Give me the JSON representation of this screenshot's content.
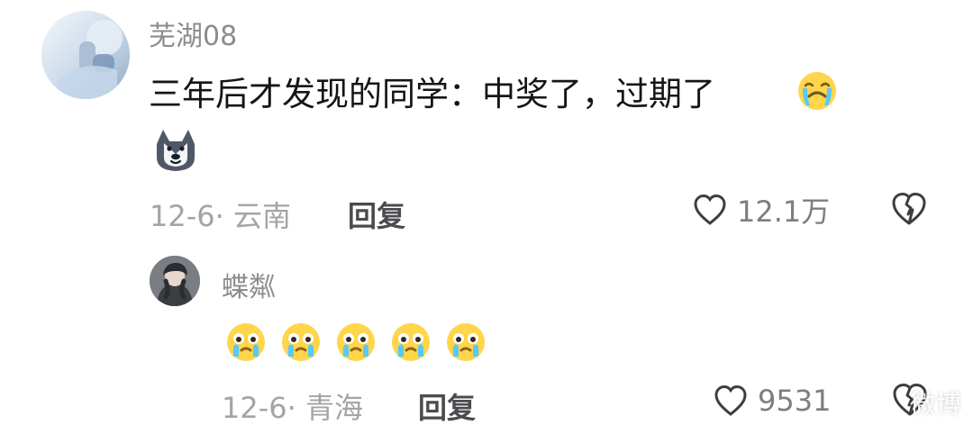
{
  "comments": [
    {
      "username": "芜湖08",
      "text": "三年后才发现的同学：中奖了，过期了",
      "time_location": "12-6· 云南",
      "reply_label": "回复",
      "likes": "12.1万",
      "icons": {
        "crying_emoji": "crying-emoji-icon",
        "dog_sticker": "husky-sticker-icon",
        "heart": "heart-outline-icon",
        "dislike": "broken-heart-icon"
      }
    },
    {
      "username": "蝶粼",
      "time_location": "12-6· 青海",
      "reply_label": "回复",
      "likes": "9531",
      "emoji_count": 5,
      "icons": {
        "tears": "tearful-emoji-icon",
        "heart": "heart-outline-icon",
        "dislike": "broken-heart-icon"
      }
    }
  ],
  "watermark": "微博"
}
